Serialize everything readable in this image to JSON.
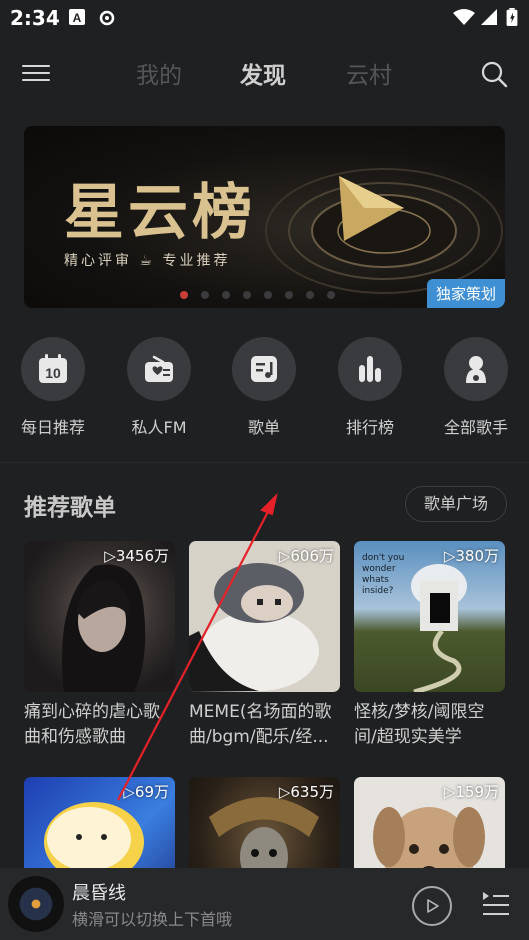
{
  "status_bar": {
    "time": "2:34",
    "icons": [
      "a-box-icon",
      "netease-icon",
      "wifi-icon",
      "signal-icon",
      "battery-icon"
    ]
  },
  "nav": {
    "tabs": [
      {
        "label": "我的"
      },
      {
        "label": "发现"
      },
      {
        "label": "云村"
      }
    ],
    "active_tab": "发现"
  },
  "banner": {
    "title": "星云榜",
    "subtitle": "精心评审 ☕ 专业推荐",
    "badge": "独家策划",
    "dots_total": 8,
    "dots_active_index": 0
  },
  "quick_actions": [
    {
      "label": "每日推荐",
      "icon": "calendar-icon",
      "glyph": "10"
    },
    {
      "label": "私人FM",
      "icon": "radio-icon"
    },
    {
      "label": "歌单",
      "icon": "playlist-icon"
    },
    {
      "label": "排行榜",
      "icon": "chart-bars-icon"
    },
    {
      "label": "全部歌手",
      "icon": "singer-icon"
    }
  ],
  "recommend": {
    "title": "推荐歌单",
    "plaza_button": "歌单广场",
    "playlists": [
      {
        "plays": "3456万",
        "title": "痛到心碎的虐心歌曲和伤感歌曲"
      },
      {
        "plays": "606万",
        "title": "MEME(名场面的歌曲/bgm/配乐/经..."
      },
      {
        "plays": "380万",
        "title": "怪核/梦核/阈限空间/超现实美学",
        "cover_text": "don't you wonder whats inside?"
      },
      {
        "plays": "69万",
        "title": ""
      },
      {
        "plays": "635万",
        "title": ""
      },
      {
        "plays": "159万",
        "title": ""
      }
    ]
  },
  "player": {
    "song": "晨昏线",
    "hint": "横滑可以切换上下首哦"
  },
  "colors": {
    "accent_red": "#c9403a",
    "badge_blue": "#3f8fd4",
    "annotation_arrow": "#e5212a"
  }
}
